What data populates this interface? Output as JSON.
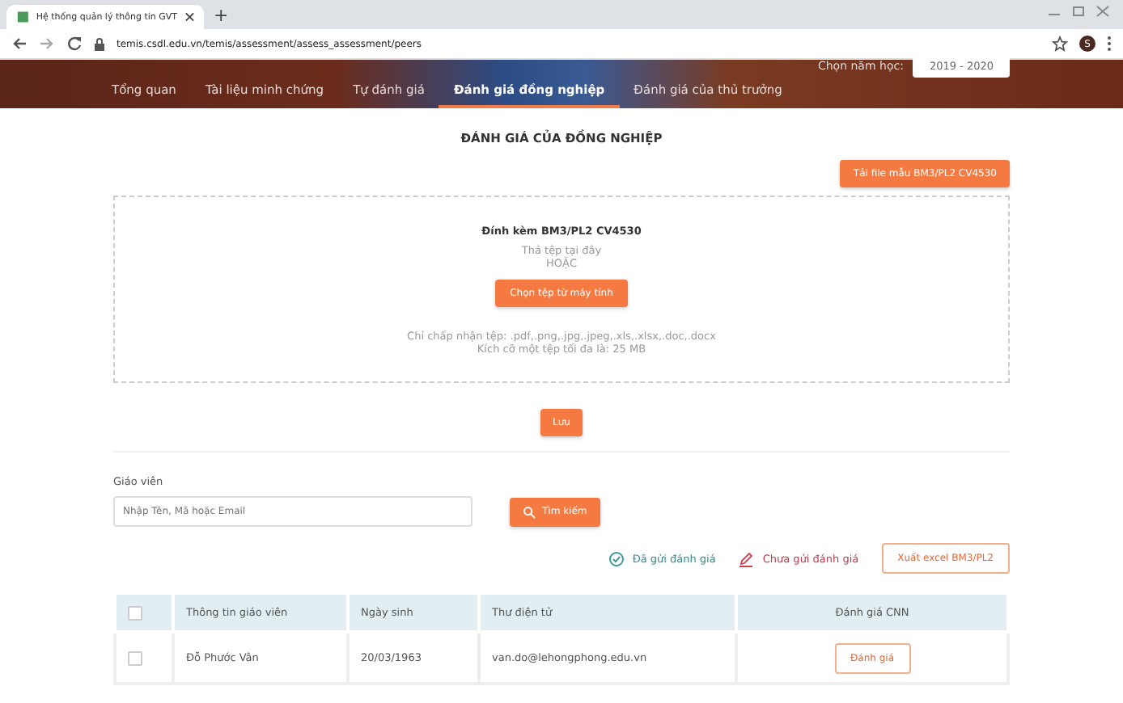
{
  "browser": {
    "tab_title": "Hệ thống quản lý thông tin GVT",
    "new_tab": "+",
    "url": "temis.csdl.edu.vn/temis/assessment/assess_assessment/peers",
    "avatar": "S"
  },
  "header": {
    "year_label": "Chọn năm học:",
    "year_value": "2019 - 2020"
  },
  "nav": [
    {
      "label": "Tổng quan",
      "selected": false
    },
    {
      "label": "Tài liệu minh chứng",
      "selected": false
    },
    {
      "label": "Tự đánh giá",
      "selected": false
    },
    {
      "label": "Đánh giá đồng nghiệp",
      "selected": true
    },
    {
      "label": "Đánh giá của thủ trưởng",
      "selected": false
    }
  ],
  "page_title": "ĐÁNH GIÁ CỦA ĐỒNG NGHIỆP",
  "download_button": "Tải file mẫu BM3/PL2 CV4530",
  "upload": {
    "title": "Đính kèm BM3/PL2 CV4530",
    "drop_hint": "Thả tệp tại đây",
    "or": "HOẶC",
    "choose_button": "Chọn tệp từ máy tính",
    "accepted": "Chỉ chấp nhận tệp: .pdf,.png,.jpg,.jpeg,.xls,.xlsx,.doc,.docx",
    "max_size": "Kích cỡ một tệp tối đa là: 25 MB"
  },
  "save_button": "Lưu",
  "search": {
    "label": "Giáo viên",
    "placeholder": "Nhập Tên, Mã hoặc Email",
    "button": "Tìm kiếm"
  },
  "legend": [
    {
      "kind": "sent",
      "label": "Đã gửi đánh giá"
    },
    {
      "kind": "unsent",
      "label": "Chưa gửi đánh giá"
    }
  ],
  "export_button": "Xuất excel BM3/PL2",
  "table": {
    "select_all_checked": false,
    "columns": [
      "Thông tin giáo viên",
      "Ngày sinh",
      "Thư điện tử",
      "Đánh giá CNN"
    ],
    "rows": [
      {
        "checked": false,
        "name": "Đỗ Phước Vân",
        "birthday": "20/03/1963",
        "email": "van.do@lehongphong.edu.vn",
        "action": "Đánh giá"
      }
    ]
  }
}
